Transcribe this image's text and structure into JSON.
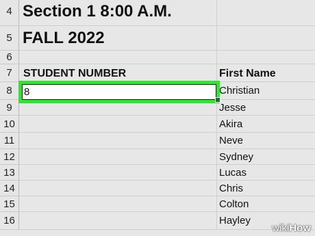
{
  "rows": [
    {
      "num": "4",
      "a": "Section 1  8:00 A.M.",
      "b": ""
    },
    {
      "num": "5",
      "a": "FALL 2022",
      "b": ""
    },
    {
      "num": "6",
      "a": "",
      "b": ""
    },
    {
      "num": "7",
      "a": "STUDENT NUMBER",
      "b": "First Name"
    },
    {
      "num": "8",
      "a": "8",
      "b": "Christian"
    },
    {
      "num": "9",
      "a": "",
      "b": "Jesse"
    },
    {
      "num": "10",
      "a": "",
      "b": "Akira"
    },
    {
      "num": "11",
      "a": "",
      "b": "Neve"
    },
    {
      "num": "12",
      "a": "",
      "b": "Sydney"
    },
    {
      "num": "13",
      "a": "",
      "b": "Lucas"
    },
    {
      "num": "14",
      "a": "",
      "b": "Chris"
    },
    {
      "num": "15",
      "a": "",
      "b": "Colton"
    },
    {
      "num": "16",
      "a": "",
      "b": "Hayley"
    }
  ],
  "watermark": {
    "prefix": "wiki",
    "suffix": "How"
  },
  "colors": {
    "selection_border": "#2ee62e",
    "grid_bg": "#e7e7e7"
  }
}
